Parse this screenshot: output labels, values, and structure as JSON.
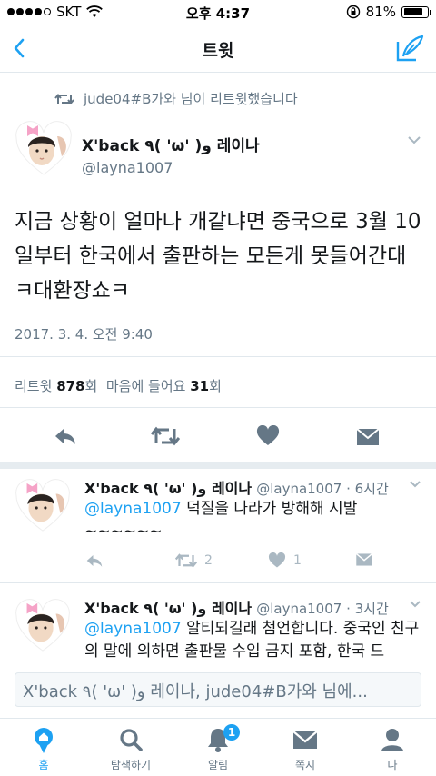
{
  "status_bar": {
    "carrier": "SKT",
    "time": "오후 4:37",
    "battery": "81%",
    "battery_level": 0.81
  },
  "nav": {
    "title": "트윗"
  },
  "retweet_note": "jude04#B가와 님이 리트윗했습니다",
  "tweet": {
    "author_name": "X'back ٩( 'ω' )و 레이나",
    "author_handle": "@layna1007",
    "text": "지금 상황이 얼마나 개같냐면 중국으로 3월 10일부터 한국에서 출판하는 모든게 못들어간대ㅋ대환장쇼ㅋ",
    "timestamp": "2017. 3. 4. 오전 9:40",
    "stats": {
      "retweet_label": "리트윗",
      "retweet_count": "878",
      "retweet_unit": "회",
      "like_label": "마음에 들어요",
      "like_count": "31",
      "like_unit": "회"
    }
  },
  "replies": [
    {
      "author_name": "X'back ٩( 'ω' )و 레이나",
      "handle_time": "@layna1007 · 6시간",
      "mention": "@layna1007",
      "text": "덕질을 나라가 방해해 시발 ~~~~~~",
      "retweet_count": "2",
      "like_count": "1"
    },
    {
      "author_name": "X'back ٩( 'ω' )و 레이나",
      "handle_time": "@layna1007 · 3시간",
      "mention": "@layna1007",
      "text": "알티되길래 첨언합니다. 중국인 친구의 말에 의하면 출판물 수입 금지 포함, 한국 드"
    }
  ],
  "compose": {
    "placeholder": "X'back ٩( 'ω' )و 레이나, jude04#B가와 님에..."
  },
  "tabs": [
    {
      "label": "홈",
      "icon": "home-icon"
    },
    {
      "label": "탐색하기",
      "icon": "search-icon"
    },
    {
      "label": "알림",
      "icon": "bell-icon",
      "badge": "1"
    },
    {
      "label": "쪽지",
      "icon": "mail-icon"
    },
    {
      "label": "나",
      "icon": "profile-icon"
    }
  ],
  "colors": {
    "accent": "#1da1f2",
    "muted": "#657786",
    "icon_gray": "#aab8c2"
  }
}
